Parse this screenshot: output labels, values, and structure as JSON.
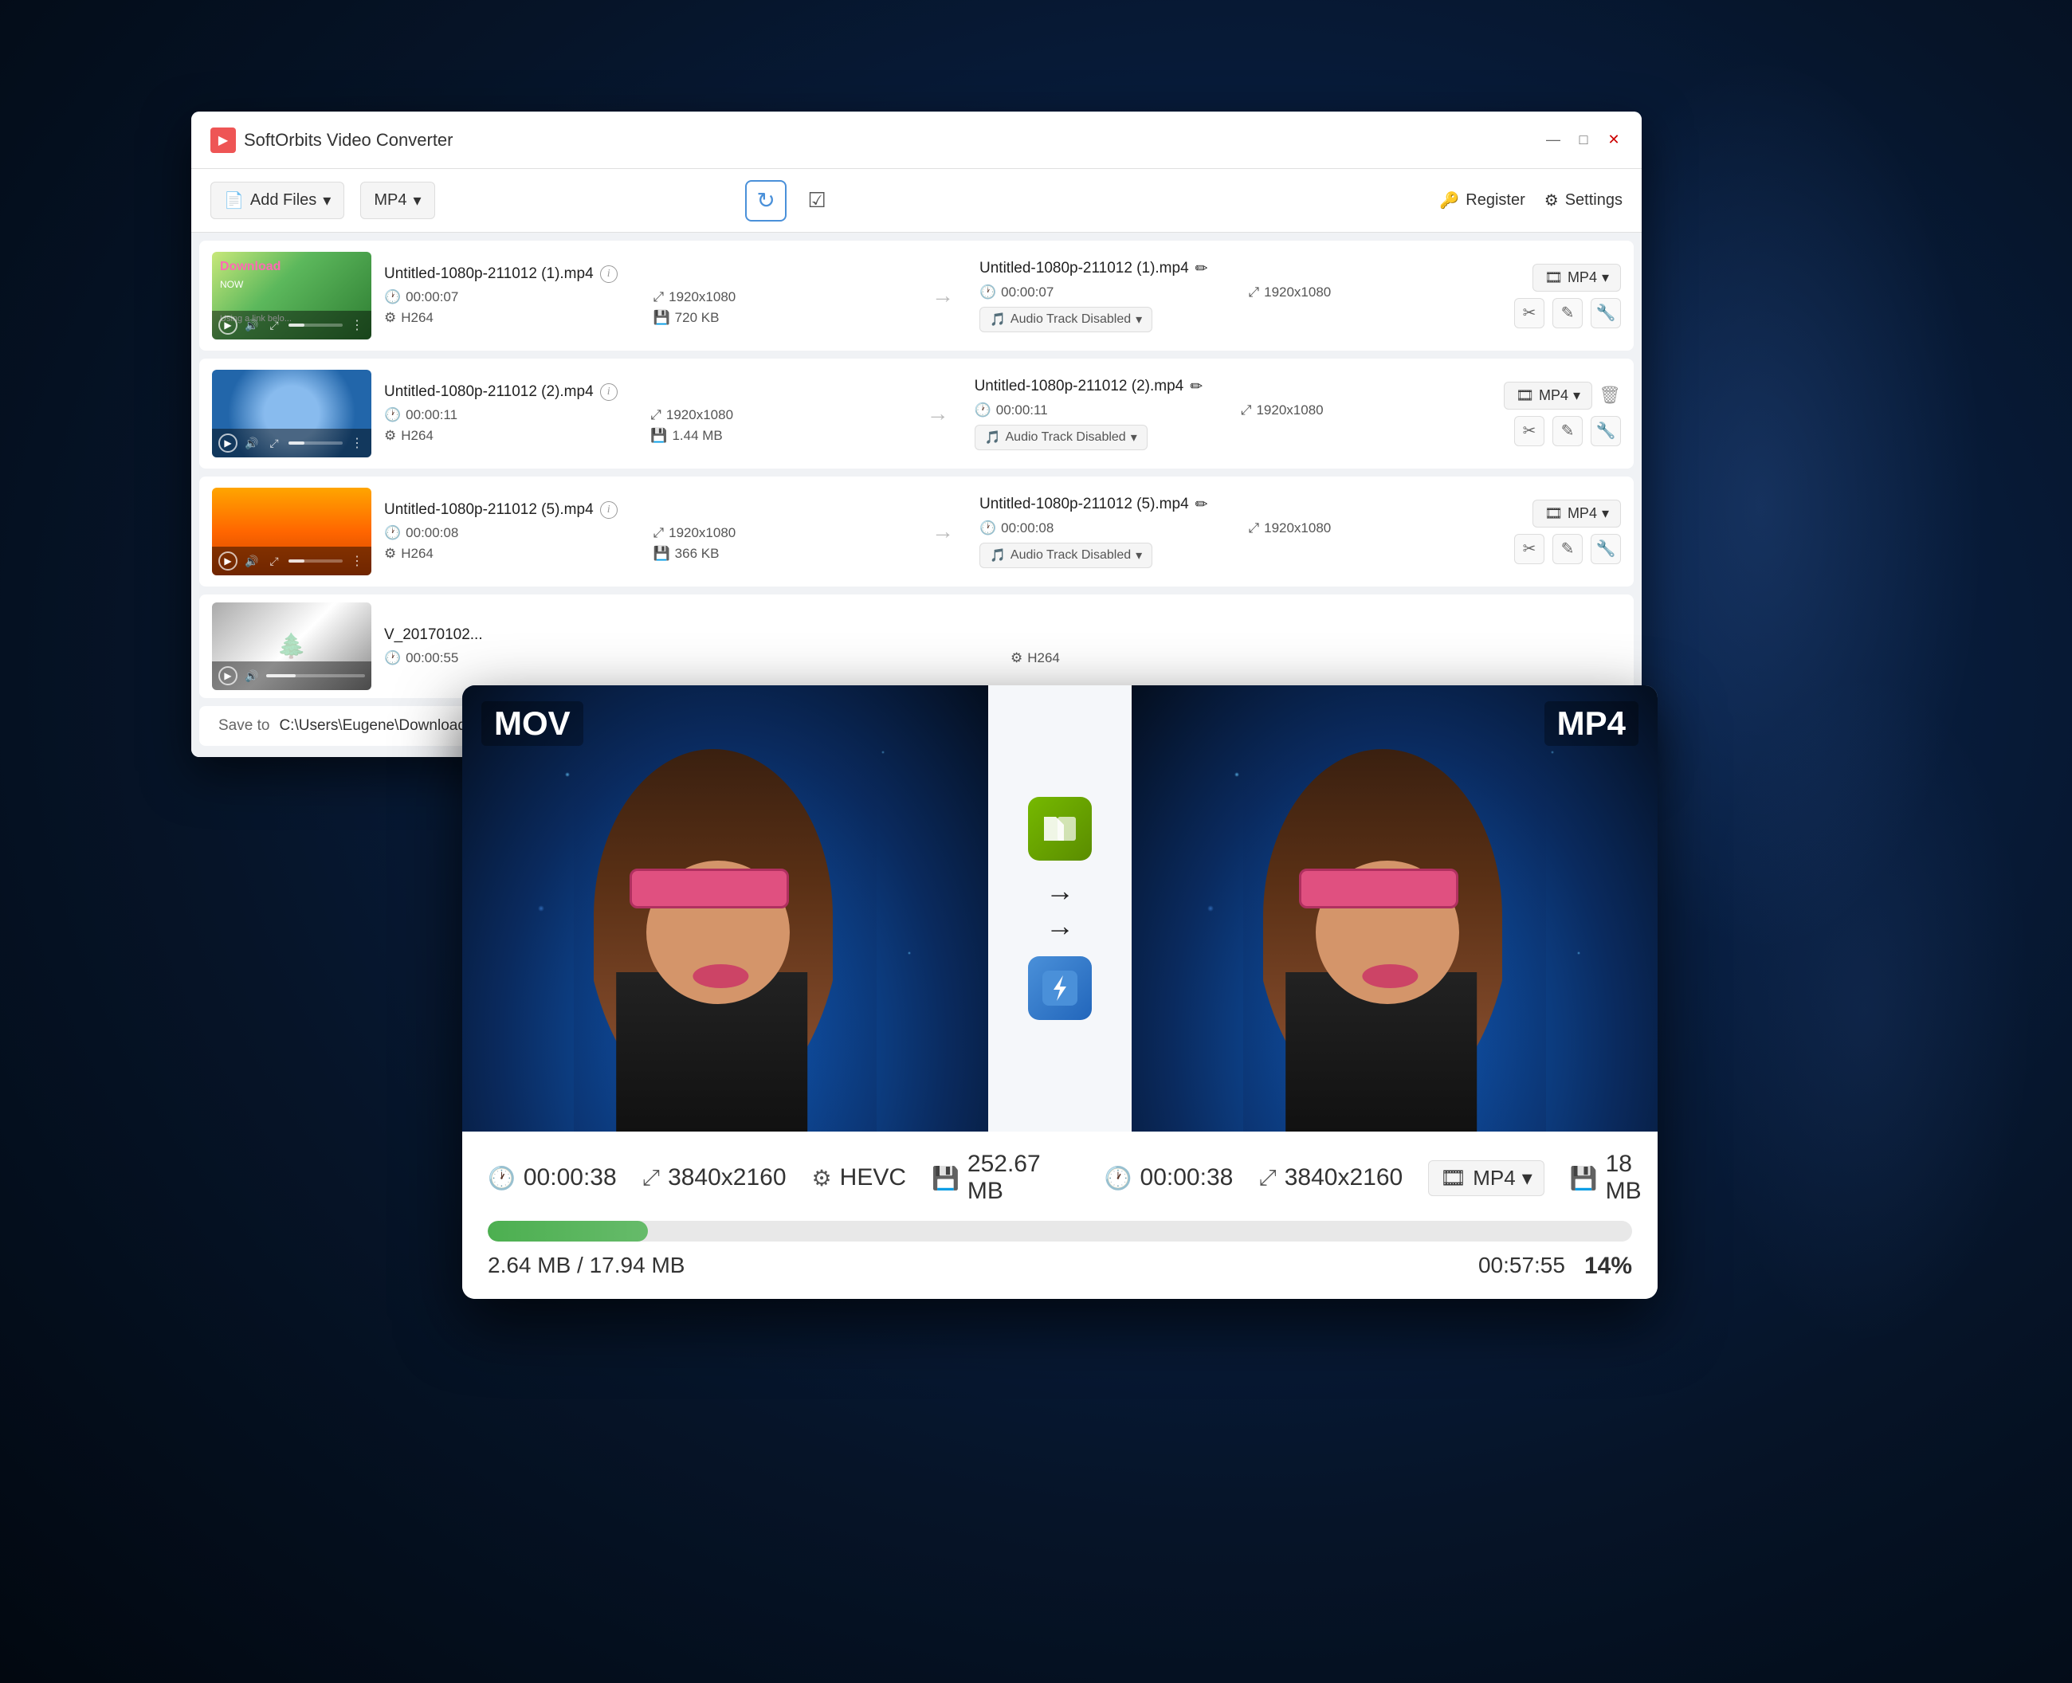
{
  "app": {
    "title": "SoftOrbits Video Converter",
    "icon": "🎬"
  },
  "titlebar": {
    "minimize": "—",
    "maximize": "□",
    "close": "✕"
  },
  "toolbar": {
    "add_files": "Add Files",
    "format": "MP4",
    "format_arrow": "▾",
    "refresh_icon": "↻",
    "check_icon": "✓",
    "register": "Register",
    "settings": "Settings"
  },
  "files": [
    {
      "name": "Untitled-1080p-211012 (1).mp4",
      "duration": "00:00:07",
      "resolution": "1920x1080",
      "codec": "H264",
      "size": "720 KB",
      "output_name": "Untitled-1080p-211012 (1).mp4",
      "output_duration": "00:00:07",
      "output_resolution": "1920x1080",
      "audio_track": "Audio Track Disabled",
      "format": "MP4",
      "thumb_class": "thumb-1"
    },
    {
      "name": "Untitled-1080p-211012 (2).mp4",
      "duration": "00:00:11",
      "resolution": "1920x1080",
      "codec": "H264",
      "size": "1.44 MB",
      "output_name": "Untitled-1080p-211012 (2).mp4",
      "output_duration": "00:00:11",
      "output_resolution": "1920x1080",
      "audio_track": "Audio Track Disabled",
      "format": "MP4",
      "thumb_class": "thumb-2"
    },
    {
      "name": "Untitled-1080p-211012 (5).mp4",
      "duration": "00:00:08",
      "resolution": "1920x1080",
      "codec": "H264",
      "size": "366 KB",
      "output_name": "Untitled-1080p-211012 (5).mp4",
      "output_duration": "00:00:08",
      "output_resolution": "1920x1080",
      "audio_track": "Audio Track Disabled",
      "format": "MP4",
      "thumb_class": "thumb-3"
    },
    {
      "name": "V_20170102...",
      "duration": "00:00:55",
      "resolution": "",
      "codec": "H264",
      "size": "",
      "output_name": "",
      "output_duration": "",
      "output_resolution": "",
      "audio_track": "",
      "format": "",
      "thumb_class": "thumb-4"
    }
  ],
  "save_to": {
    "label": "Save to",
    "path": "C:\\Users\\Eugene\\Downloads"
  },
  "popup": {
    "left_format": "MOV",
    "right_format": "MP4",
    "left_duration": "00:00:38",
    "left_resolution": "3840x2160",
    "left_codec": "HEVC",
    "left_size": "252.67 MB",
    "right_duration": "00:00:38",
    "right_resolution": "3840x2160",
    "right_format_select": "MP4",
    "right_size": "18 MB",
    "progress_fill_pct": "14%",
    "progress_size_current": "2.64 MB",
    "progress_size_total": "17.94 MB",
    "progress_display": "2.64 MB / 17.94 MB",
    "time_remaining": "00:57:55",
    "percent": "14%"
  },
  "icons": {
    "clock": "🕐",
    "expand": "⤢",
    "gear": "⚙",
    "film": "🎞",
    "music": "🎵",
    "hdd": "💾",
    "scissors": "✂",
    "edit": "✎",
    "wrench": "🔧",
    "trash": "🗑",
    "info": "i",
    "pencil": "✏",
    "key": "🔑",
    "settings_gear": "⚙"
  }
}
